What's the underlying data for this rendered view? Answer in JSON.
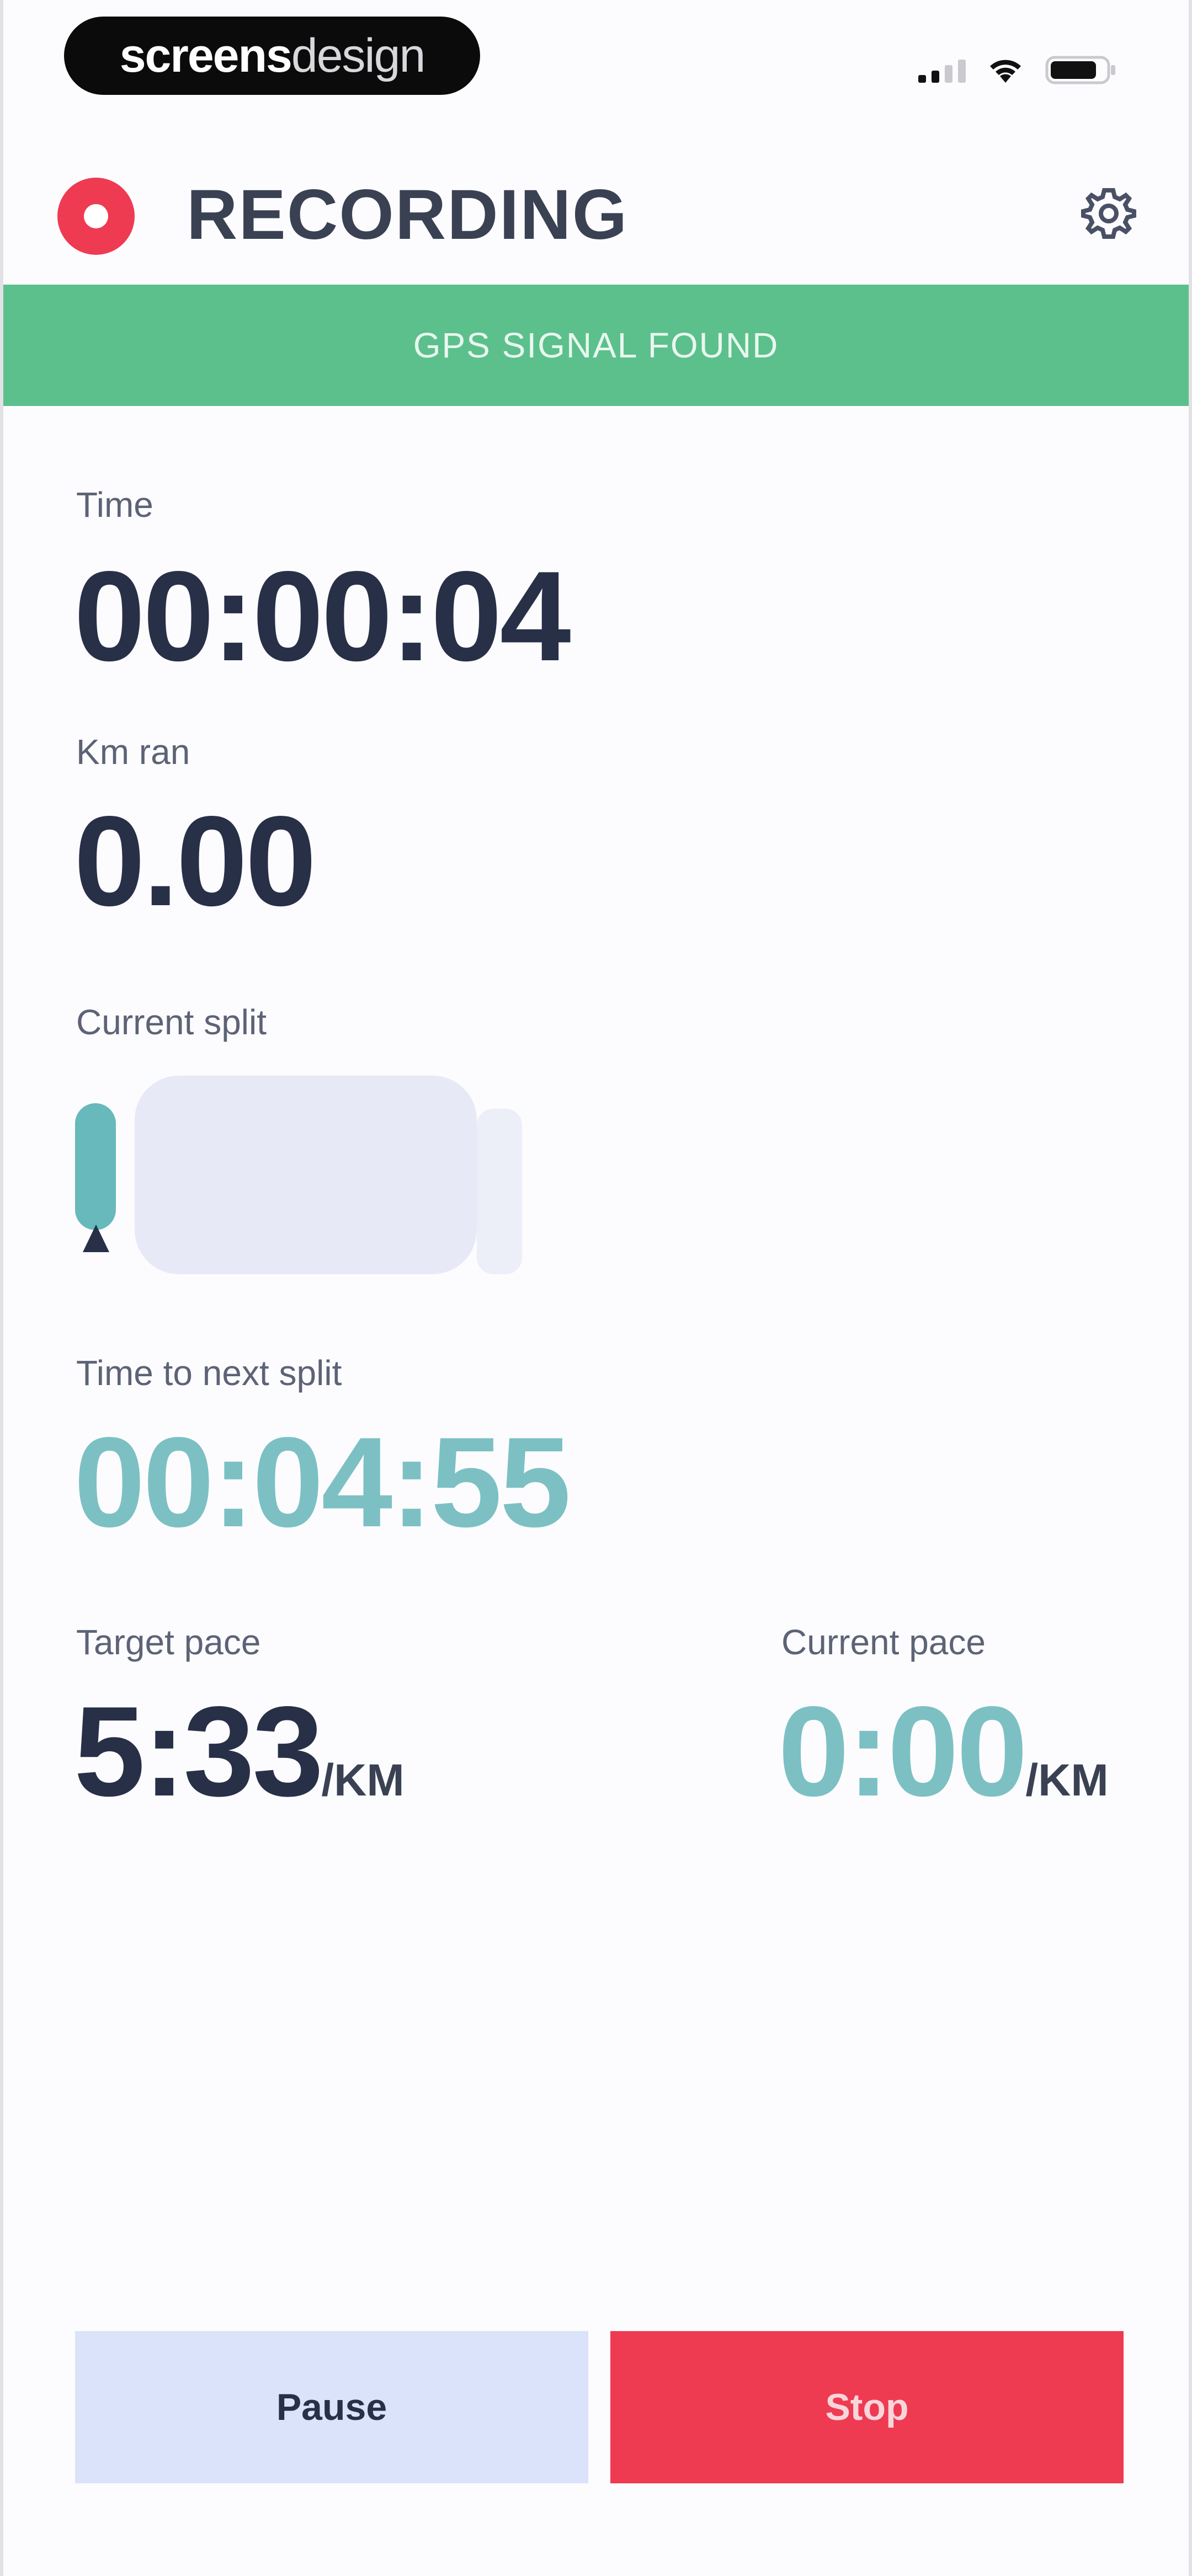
{
  "status_bar": {
    "brand_part1": "screens",
    "brand_part2": "design"
  },
  "header": {
    "title": "RECORDING",
    "record_icon": "record-icon",
    "settings_icon": "gear-icon"
  },
  "gps": {
    "message": "GPS SIGNAL FOUND"
  },
  "metrics": {
    "time_label": "Time",
    "time_value": "00:00:04",
    "distance_label": "Km ran",
    "distance_value": "0.00",
    "split_label": "Current split",
    "next_split_label": "Time to next split",
    "next_split_value": "00:04:55",
    "target_pace_label": "Target pace",
    "target_pace_value": "5:33",
    "target_pace_unit": "/KM",
    "current_pace_label": "Current pace",
    "current_pace_value": "0:00",
    "current_pace_unit": "/KM"
  },
  "actions": {
    "pause_label": "Pause",
    "stop_label": "Stop"
  },
  "colors": {
    "accent_red": "#ee3b52",
    "gps_green": "#5cc08c",
    "teal": "#7cc0c4",
    "navy": "#283048",
    "pause_bg": "#dbe3fb"
  }
}
